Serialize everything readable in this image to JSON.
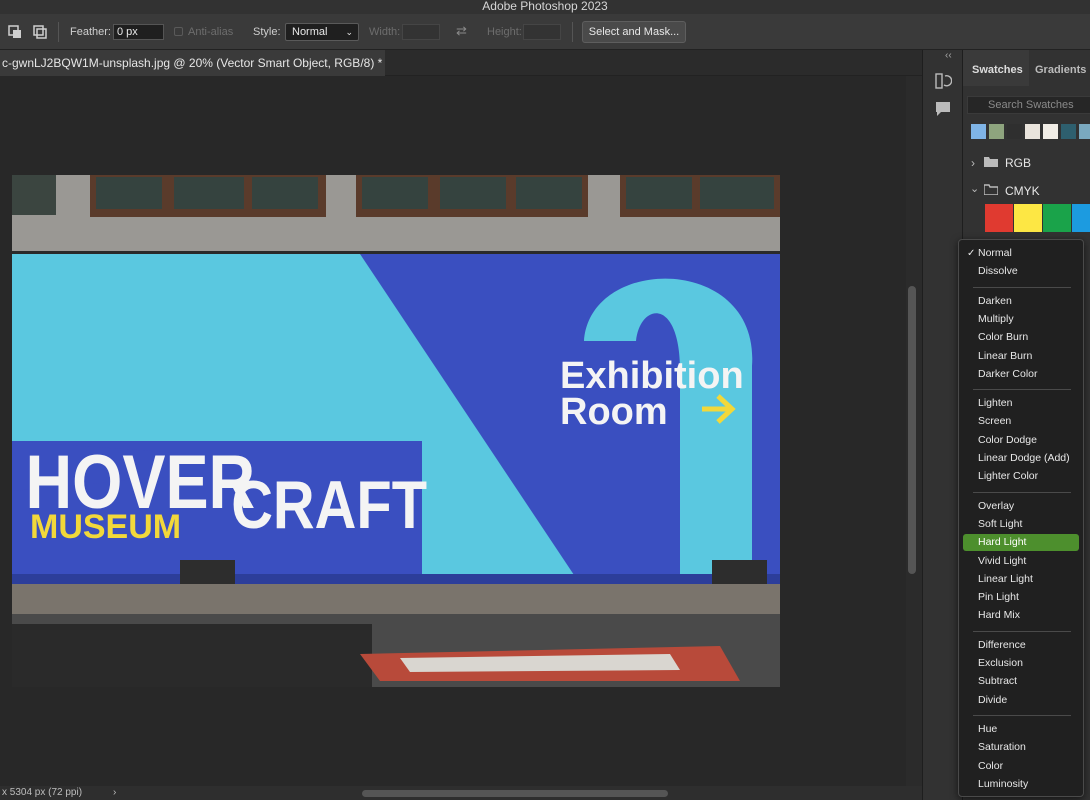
{
  "app": {
    "title": "Adobe Photoshop 2023"
  },
  "options_bar": {
    "feather_label": "Feather:",
    "feather_value": "0 px",
    "antialias_label": "Anti-alias",
    "style_label": "Style:",
    "style_value": "Normal",
    "width_label": "Width:",
    "height_label": "Height:",
    "select_mask_label": "Select and Mask..."
  },
  "document": {
    "tab_title": "c-gwnLJ2BQW1M-unsplash.jpg @ 20% (Vector Smart Object, RGB/8) *",
    "status_text": "x 5304 px (72 ppi)"
  },
  "artwork": {
    "headline_left": "HOVER",
    "headline_right": "CRAFT",
    "subline": "MUSEUM",
    "sign_line1": "Exhibition",
    "sign_line2": "Room",
    "room_number": "2"
  },
  "panel": {
    "tab_swatches": "Swatches",
    "tab_gradients": "Gradients",
    "search_placeholder": "Search Swatches",
    "group_rgb": "RGB",
    "group_cmyk": "CMYK",
    "recent_swatches": [
      "#7fb4e6",
      "#8ea47e",
      "#2f2f2f",
      "#e9e4dc",
      "#f1ede6",
      "#2e5f6e",
      "#7aa9bf"
    ],
    "cmyk_swatches": [
      "#e03a30",
      "#fde744",
      "#1aa34a",
      "#1c9be0"
    ]
  },
  "blend_menu": {
    "selected": "Hard Light",
    "checked": "Normal",
    "groups": [
      [
        "Normal",
        "Dissolve"
      ],
      [
        "Darken",
        "Multiply",
        "Color Burn",
        "Linear Burn",
        "Darker Color"
      ],
      [
        "Lighten",
        "Screen",
        "Color Dodge",
        "Linear Dodge (Add)",
        "Lighter Color"
      ],
      [
        "Overlay",
        "Soft Light",
        "Hard Light",
        "Vivid Light",
        "Linear Light",
        "Pin Light",
        "Hard Mix"
      ],
      [
        "Difference",
        "Exclusion",
        "Subtract",
        "Divide"
      ],
      [
        "Hue",
        "Saturation",
        "Color",
        "Luminosity"
      ]
    ]
  }
}
